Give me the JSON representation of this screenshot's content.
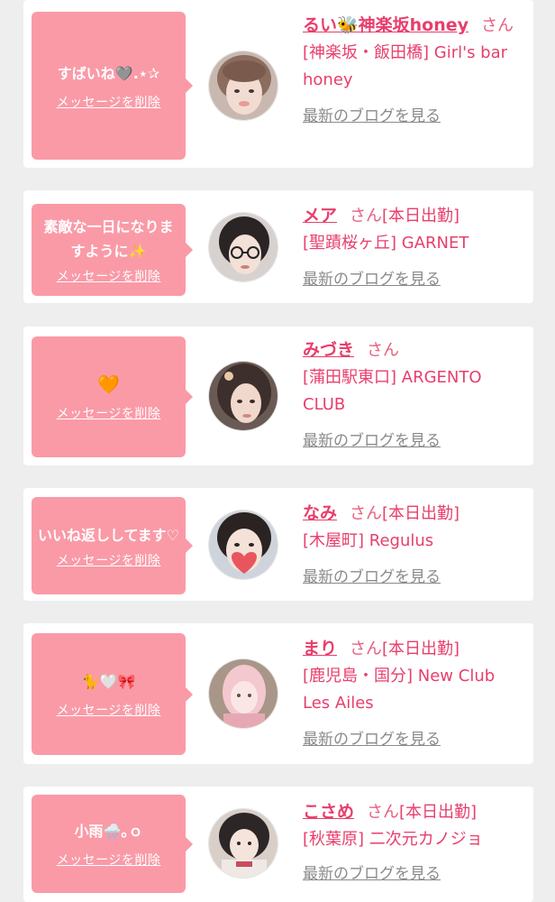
{
  "cards": [
    {
      "message": "すばいね🩶.⋆✰",
      "delete_label": "メッセージを削除",
      "name": "るい🐝神楽坂honey",
      "honorific": "さん",
      "status": "",
      "shop": "[神楽坂・飯田橋] Girl's bar honey",
      "blog_label": "最新のブログを見る"
    },
    {
      "message": "素敵な一日になりますように✨",
      "delete_label": "メッセージを削除",
      "name": "メア",
      "honorific": "さん",
      "status": "[本日出勤]",
      "shop": "[聖蹟桜ヶ丘] GARNET",
      "blog_label": "最新のブログを見る"
    },
    {
      "message": "🧡",
      "delete_label": "メッセージを削除",
      "name": "みづき",
      "honorific": "さん",
      "status": "",
      "shop": "[蒲田駅東口] ARGENTO CLUB",
      "blog_label": "最新のブログを見る"
    },
    {
      "message": "いいね返ししてます♡",
      "delete_label": "メッセージを削除",
      "name": "なみ",
      "honorific": "さん",
      "status": "[本日出勤]",
      "shop": "[木屋町] Regulus",
      "blog_label": "最新のブログを見る"
    },
    {
      "message": "🐈🤍🎀",
      "delete_label": "メッセージを削除",
      "name": "まり",
      "honorific": "さん",
      "status": "[本日出勤]",
      "shop": "[鹿児島・国分] New Club Les Ailes",
      "blog_label": "最新のブログを見る"
    },
    {
      "message": "小雨🌧️｡ｏ",
      "delete_label": "メッセージを削除",
      "name": "こさめ",
      "honorific": "さん",
      "status": "[本日出勤]",
      "shop": "[秋葉原] 二次元カノジョ",
      "blog_label": "最新のブログを見る"
    }
  ],
  "colors": {
    "bubble": "#fa9aa7",
    "name": "#e83e6c",
    "link": "#8a8a8a",
    "background": "#eeeeee"
  }
}
